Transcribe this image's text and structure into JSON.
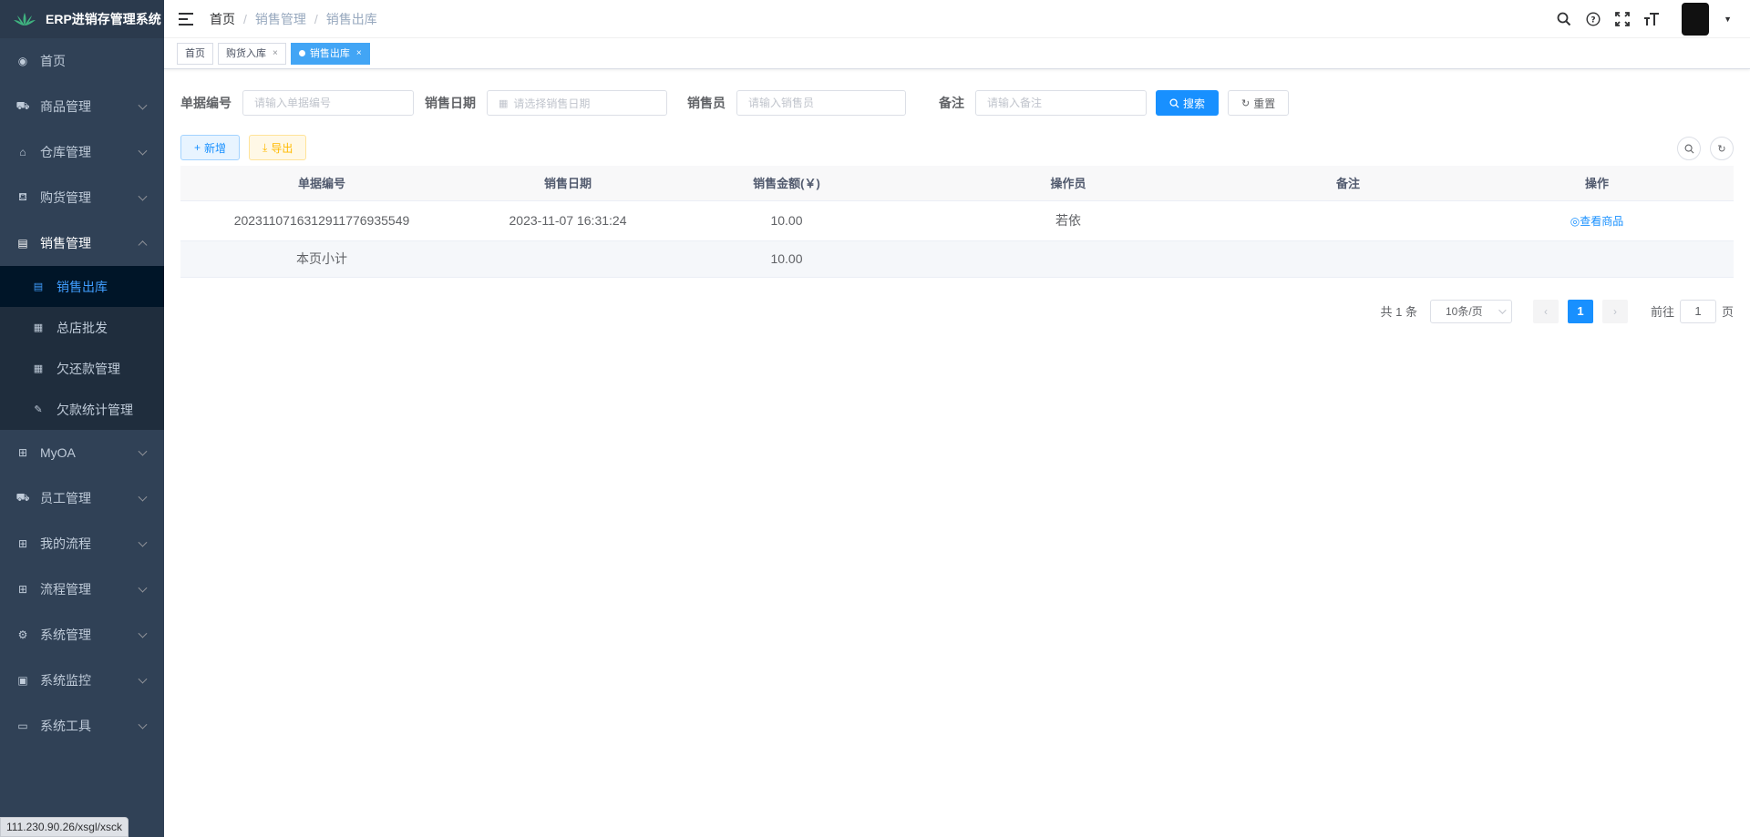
{
  "app": {
    "title": "ERP进销存管理系统"
  },
  "sidebar": {
    "items": [
      {
        "label": "首页",
        "icon": "dashboard-icon",
        "glyph": "◉"
      },
      {
        "label": "商品管理",
        "icon": "goods-icon",
        "glyph": "⛟"
      },
      {
        "label": "仓库管理",
        "icon": "warehouse-icon",
        "glyph": "⌂"
      },
      {
        "label": "购货管理",
        "icon": "cart-icon",
        "glyph": "⛾"
      },
      {
        "label": "销售管理",
        "icon": "sales-icon",
        "glyph": "▤"
      }
    ],
    "sales_sub": [
      {
        "label": "销售出库",
        "glyph": "▤"
      },
      {
        "label": "总店批发",
        "glyph": "▦"
      },
      {
        "label": "欠还款管理",
        "glyph": "▦"
      },
      {
        "label": "欠款统计管理",
        "glyph": "✎"
      }
    ],
    "items_after": [
      {
        "label": "MyOA",
        "glyph": "⊞"
      },
      {
        "label": "员工管理",
        "glyph": "⛟"
      },
      {
        "label": "我的流程",
        "glyph": "⊞"
      },
      {
        "label": "流程管理",
        "glyph": "⊞"
      },
      {
        "label": "系统管理",
        "glyph": "⚙"
      },
      {
        "label": "系统监控",
        "glyph": "▣"
      },
      {
        "label": "系统工具",
        "glyph": "▭"
      }
    ]
  },
  "breadcrumb": {
    "home": "首页",
    "level1": "销售管理",
    "level2": "销售出库",
    "sep": "/"
  },
  "tags": {
    "home": "首页",
    "purchase": "购货入库",
    "sales": "销售出库",
    "close": "×"
  },
  "search": {
    "doc_no_label": "单据编号",
    "doc_no_placeholder": "请输入单据编号",
    "date_label": "销售日期",
    "date_placeholder": "请选择销售日期",
    "seller_label": "销售员",
    "seller_placeholder": "请输入销售员",
    "remark_label": "备注",
    "remark_placeholder": "请输入备注",
    "search_btn": "搜索",
    "reset_btn": "重置"
  },
  "toolbar": {
    "add": "新增",
    "export": "导出"
  },
  "table": {
    "headers": [
      "单据编号",
      "销售日期",
      "销售金额(￥)",
      "操作员",
      "备注",
      "操作"
    ],
    "rows": [
      {
        "doc_no": "20231107163129117769355​49",
        "date": "2023-11-07 16:31:24",
        "amount": "10.00",
        "operator": "若依",
        "remark": "",
        "action": "查看商品"
      }
    ],
    "subtotal": {
      "label": "本页小计",
      "amount": "10.00"
    }
  },
  "pagination": {
    "total": "共 1 条",
    "page_size": "10条/页",
    "current": "1",
    "goto_label": "前往",
    "goto_value": "1",
    "page_suffix": "页"
  },
  "status_url": "111.230.90.26/xsgl/xsck",
  "colors": {
    "sidebar_bg": "#304156",
    "accent": "#1890ff",
    "active_tag": "#42a5f5"
  }
}
